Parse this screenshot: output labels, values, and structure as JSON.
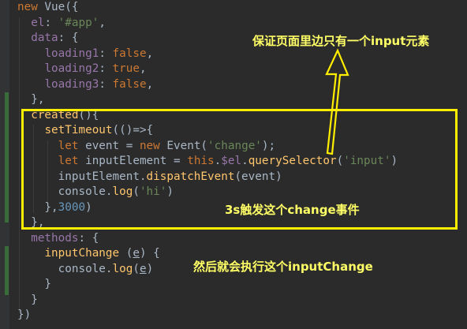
{
  "code_lines": [
    "new Vue({",
    "  el: '#app',",
    "  data: {",
    "    loading1: false,",
    "    loading2: true,",
    "    loading3: false,",
    "  },",
    "  created(){",
    "    setTimeout(()=>{",
    "      let event = new Event('change');",
    "      let inputElement = this.$el.querySelector('input')",
    "      inputElement.dispatchEvent(event)",
    "      console.log('hi')",
    "    },3000)",
    "  },",
    "  methods: {",
    "    inputChange (e) {",
    "      console.log(e)",
    "    }",
    "  }",
    "})"
  ],
  "annotations": {
    "top_note": "保证页面里边只有一个input元素",
    "middle_note": "3s触发这个change事件",
    "bottom_note": "然后就会执行这个inputChange"
  },
  "colors": {
    "background": "#2b2b2b",
    "keyword": "#cc7832",
    "string": "#6a8759",
    "property": "#9876aa",
    "function": "#ffc66d",
    "number": "#6897bb",
    "annotation": "#ffee00"
  }
}
